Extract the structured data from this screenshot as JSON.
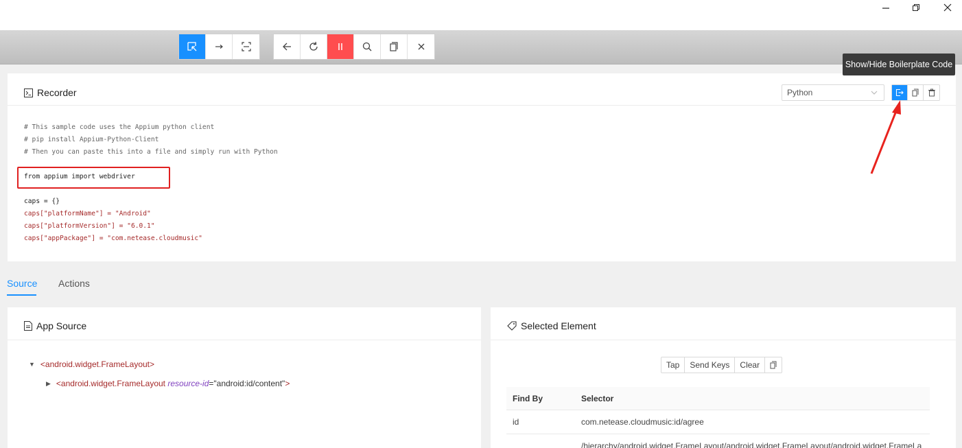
{
  "window": {
    "minimize_icon": "minimize-icon",
    "restore_icon": "restore-icon",
    "close_icon": "close-icon"
  },
  "toolbar": {
    "group1": [
      "select-elements-icon",
      "swipe-icon",
      "tap-by-coordinates-icon"
    ],
    "group2": [
      "back-icon",
      "refresh-icon",
      "pause-recording-icon",
      "search-icon",
      "copy-xml-icon",
      "quit-session-icon"
    ],
    "accent": "#1890ff",
    "recording_color": "#ff4d4f"
  },
  "tooltip": {
    "text": "Show/Hide Boilerplate Code"
  },
  "recorder": {
    "title": "Recorder",
    "language": "Python",
    "code_lines": [
      "# This sample code uses the Appium python client",
      "# pip install Appium-Python-Client",
      "# Then you can paste this into a file and simply run with Python",
      "from appium import webdriver",
      "caps = {}",
      "caps[\"platformName\"] = \"Android\"",
      "caps[\"platformVersion\"] = \"6.0.1\"",
      "caps[\"appPackage\"] = \"com.netease.cloudmusic\""
    ]
  },
  "tabs": [
    {
      "label": "Source"
    },
    {
      "label": "Actions"
    }
  ],
  "app_source": {
    "title": "App Source",
    "nodes": [
      {
        "tag": "<android.widget.FrameLayout>"
      },
      {
        "tag_open": "<android.widget.FrameLayout",
        "attr_name": "resource-id",
        "attr_value": "=\"android:id/content\"",
        "tag_close": ">"
      }
    ]
  },
  "selected_element": {
    "title": "Selected Element",
    "actions": [
      "Tap",
      "Send Keys",
      "Clear"
    ],
    "columns": [
      "Find By",
      "Selector"
    ],
    "rows": [
      {
        "find_by": "id",
        "selector": "com.netease.cloudmusic:id/agree"
      },
      {
        "find_by": "",
        "selector": "/hierarchy/android.widget.FrameLayout/android.widget.FrameLayout/android.widget.FrameLa"
      }
    ]
  }
}
